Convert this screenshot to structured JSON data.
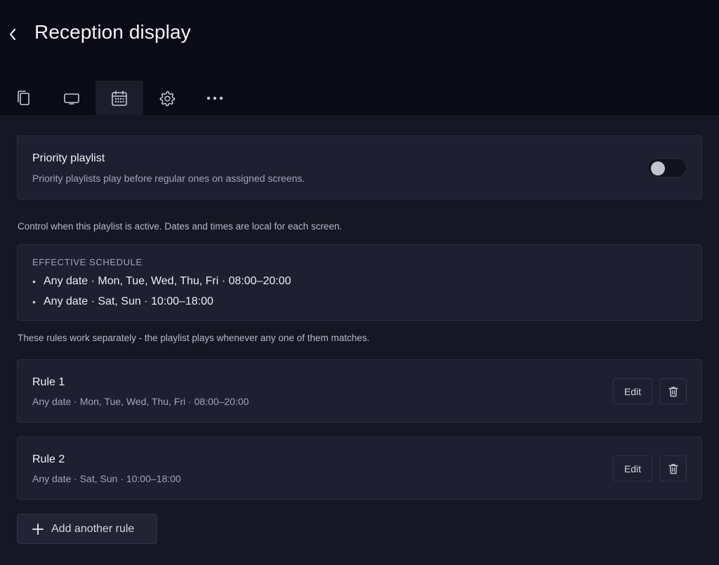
{
  "header": {
    "title": "Reception display",
    "tabs": [
      {
        "name": "pages",
        "icon": "copy-icon",
        "active": false
      },
      {
        "name": "screens",
        "icon": "display-icon",
        "active": false
      },
      {
        "name": "schedule",
        "icon": "calendar-icon",
        "active": true
      },
      {
        "name": "settings",
        "icon": "gear-icon",
        "active": false
      },
      {
        "name": "more",
        "icon": "more-horizontal-icon",
        "active": false
      }
    ]
  },
  "priority": {
    "title": "Priority playlist",
    "description": "Priority playlists play before regular ones on assigned screens.",
    "enabled": false
  },
  "control_text": "Control when this playlist is active. Dates and times are local for each screen.",
  "effective_schedule": {
    "heading": "EFFECTIVE SCHEDULE",
    "bullet": "•",
    "items": [
      "Any date · Mon, Tue, Wed, Thu, Fri · 08:00–20:00",
      "Any date · Sat, Sun · 10:00–18:00"
    ]
  },
  "rules_text": "These rules work separately - the playlist plays whenever any one of them matches.",
  "rules": [
    {
      "title": "Rule 1",
      "summary": "Any date · Mon, Tue, Wed, Thu, Fri · 08:00–20:00",
      "edit_label": "Edit"
    },
    {
      "title": "Rule 2",
      "summary": "Any date · Sat, Sun · 10:00–18:00",
      "edit_label": "Edit"
    }
  ],
  "add_rule_label": "Add another rule",
  "colors": {
    "header_bg": "#0b0b17",
    "page_bg": "#161624",
    "card_bg": "#1f1f31",
    "active_tab_bg": "#1c1c2b"
  }
}
